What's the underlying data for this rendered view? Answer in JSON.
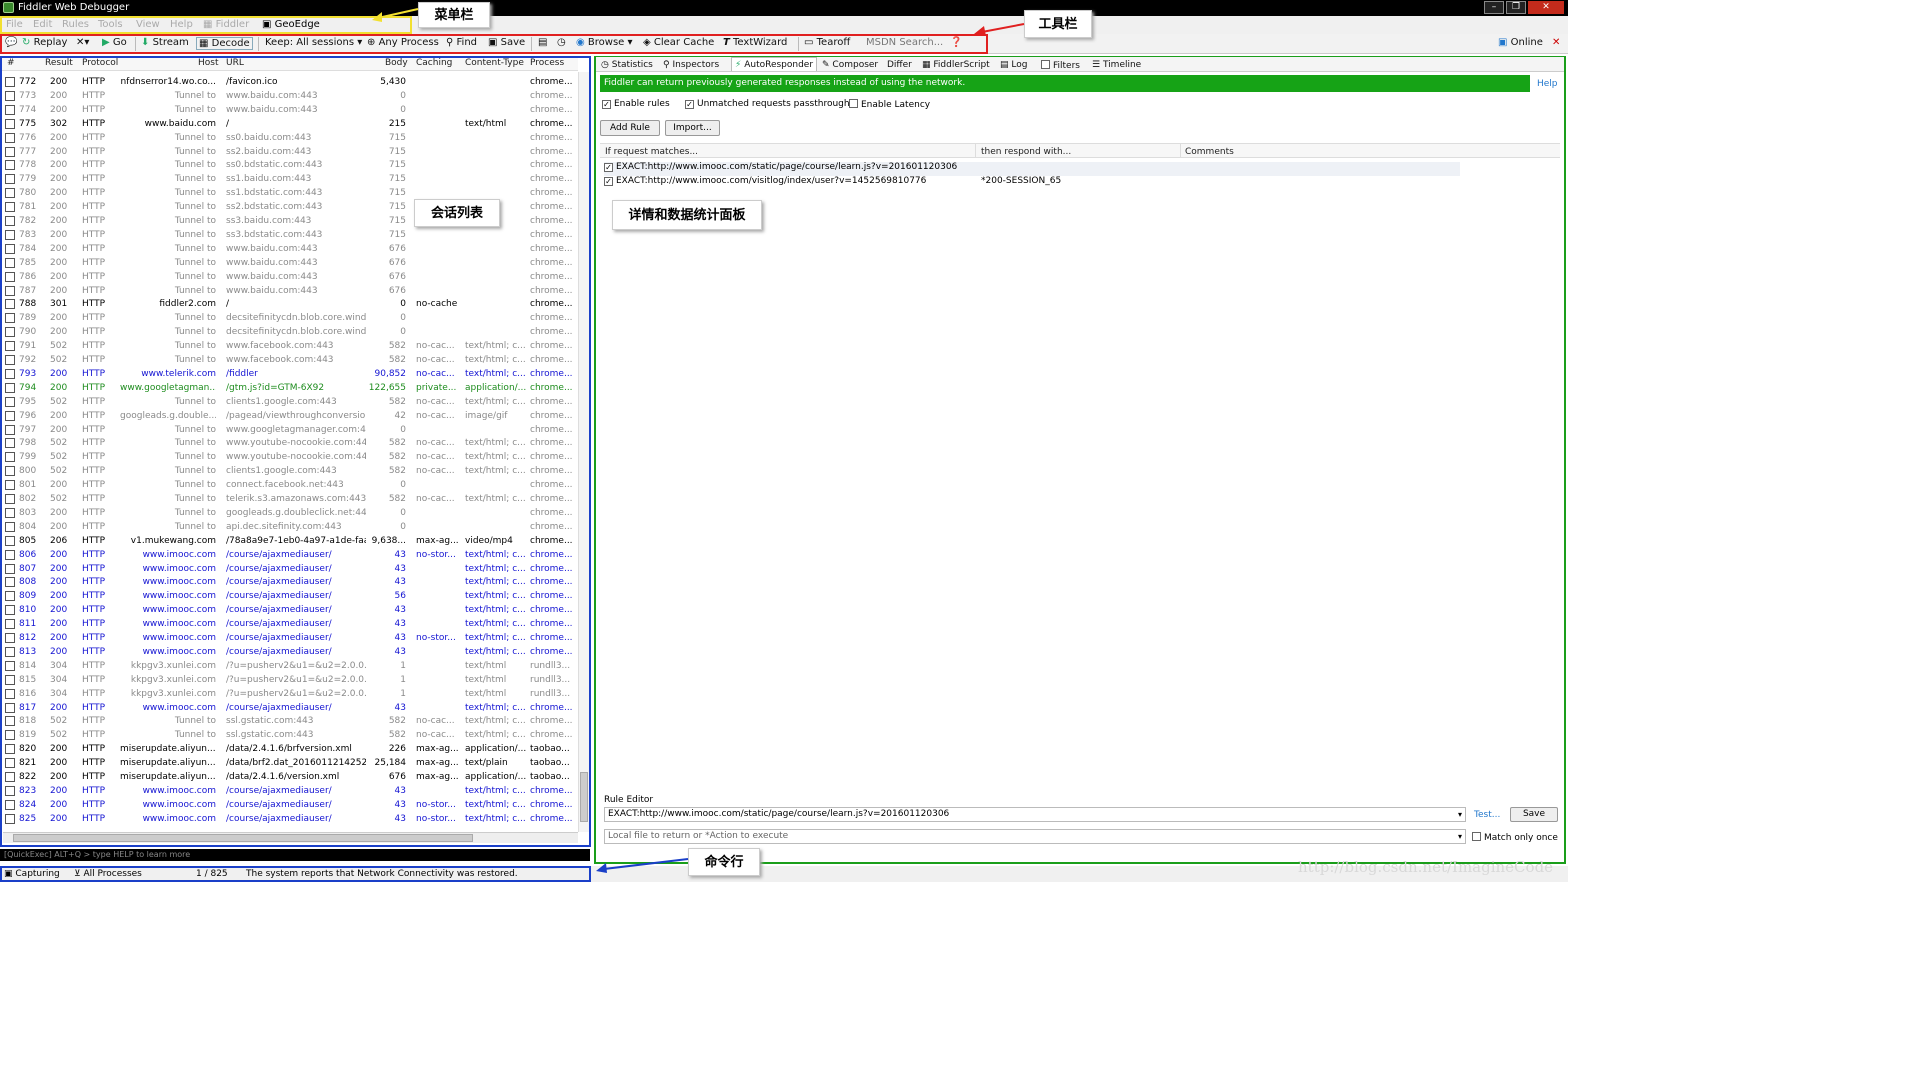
{
  "window": {
    "title": "Fiddler Web Debugger",
    "online": "Online"
  },
  "menu": [
    "File",
    "Edit",
    "Rules",
    "Tools",
    "View",
    "Help",
    "Fiddler",
    "GeoEdge"
  ],
  "toolbar": {
    "replay": "Replay",
    "go": "Go",
    "stream": "Stream",
    "decode": "Decode",
    "keep": "Keep: All sessions",
    "any_process": "Any Process",
    "find": "Find",
    "save": "Save",
    "browse": "Browse",
    "clear_cache": "Clear Cache",
    "textwizard": "TextWizard",
    "tearoff": "Tearoff",
    "msdn": "MSDN Search..."
  },
  "columns": [
    "#",
    "Result",
    "Protocol",
    "Host",
    "URL",
    "Body",
    "Caching",
    "Content-Type",
    "Process"
  ],
  "sessions": [
    [
      "772",
      "200",
      "HTTP",
      "nfdnserror14.wo.co...",
      "/favicon.ico",
      "5,430",
      "",
      "",
      "chrome...",
      "n"
    ],
    [
      "773",
      "200",
      "HTTP",
      "Tunnel to",
      "www.baidu.com:443",
      "0",
      "",
      "",
      "chrome...",
      "t"
    ],
    [
      "774",
      "200",
      "HTTP",
      "Tunnel to",
      "www.baidu.com:443",
      "0",
      "",
      "",
      "chrome...",
      "t"
    ],
    [
      "775",
      "302",
      "HTTP",
      "www.baidu.com",
      "/",
      "215",
      "",
      "text/html",
      "chrome...",
      "n"
    ],
    [
      "776",
      "200",
      "HTTP",
      "Tunnel to",
      "ss0.baidu.com:443",
      "715",
      "",
      "",
      "chrome...",
      "t"
    ],
    [
      "777",
      "200",
      "HTTP",
      "Tunnel to",
      "ss2.baidu.com:443",
      "715",
      "",
      "",
      "chrome...",
      "t"
    ],
    [
      "778",
      "200",
      "HTTP",
      "Tunnel to",
      "ss0.bdstatic.com:443",
      "715",
      "",
      "",
      "chrome...",
      "t"
    ],
    [
      "779",
      "200",
      "HTTP",
      "Tunnel to",
      "ss1.baidu.com:443",
      "715",
      "",
      "",
      "chrome...",
      "t"
    ],
    [
      "780",
      "200",
      "HTTP",
      "Tunnel to",
      "ss1.bdstatic.com:443",
      "715",
      "",
      "",
      "chrome...",
      "t"
    ],
    [
      "781",
      "200",
      "HTTP",
      "Tunnel to",
      "ss2.bdstatic.com:443",
      "715",
      "",
      "",
      "chrome...",
      "t"
    ],
    [
      "782",
      "200",
      "HTTP",
      "Tunnel to",
      "ss3.baidu.com:443",
      "715",
      "",
      "",
      "chrome...",
      "t"
    ],
    [
      "783",
      "200",
      "HTTP",
      "Tunnel to",
      "ss3.bdstatic.com:443",
      "715",
      "",
      "",
      "chrome...",
      "t"
    ],
    [
      "784",
      "200",
      "HTTP",
      "Tunnel to",
      "www.baidu.com:443",
      "676",
      "",
      "",
      "chrome...",
      "t"
    ],
    [
      "785",
      "200",
      "HTTP",
      "Tunnel to",
      "www.baidu.com:443",
      "676",
      "",
      "",
      "chrome...",
      "t"
    ],
    [
      "786",
      "200",
      "HTTP",
      "Tunnel to",
      "www.baidu.com:443",
      "676",
      "",
      "",
      "chrome...",
      "t"
    ],
    [
      "787",
      "200",
      "HTTP",
      "Tunnel to",
      "www.baidu.com:443",
      "676",
      "",
      "",
      "chrome...",
      "t"
    ],
    [
      "788",
      "301",
      "HTTP",
      "fiddler2.com",
      "/",
      "0",
      "no-cache",
      "",
      "chrome...",
      "n"
    ],
    [
      "789",
      "200",
      "HTTP",
      "Tunnel to",
      "decsitefinitycdn.blob.core.windo...",
      "0",
      "",
      "",
      "chrome...",
      "t"
    ],
    [
      "790",
      "200",
      "HTTP",
      "Tunnel to",
      "decsitefinitycdn.blob.core.windo...",
      "0",
      "",
      "",
      "chrome...",
      "t"
    ],
    [
      "791",
      "502",
      "HTTP",
      "Tunnel to",
      "www.facebook.com:443",
      "582",
      "no-cac...",
      "text/html; c...",
      "chrome...",
      "t"
    ],
    [
      "792",
      "502",
      "HTTP",
      "Tunnel to",
      "www.facebook.com:443",
      "582",
      "no-cac...",
      "text/html; c...",
      "chrome...",
      "t"
    ],
    [
      "793",
      "200",
      "HTTP",
      "www.telerik.com",
      "/fiddler",
      "90,852",
      "no-cac...",
      "text/html; c...",
      "chrome...",
      "b"
    ],
    [
      "794",
      "200",
      "HTTP",
      "www.googletagman...",
      "/gtm.js?id=GTM-6X92",
      "122,655",
      "private...",
      "application/...",
      "chrome...",
      "g"
    ],
    [
      "795",
      "502",
      "HTTP",
      "Tunnel to",
      "clients1.google.com:443",
      "582",
      "no-cac...",
      "text/html; c...",
      "chrome...",
      "t"
    ],
    [
      "796",
      "200",
      "HTTP",
      "googleads.g.double...",
      "/pagead/viewthroughconversion...",
      "42",
      "no-cac...",
      "image/gif",
      "chrome...",
      "t"
    ],
    [
      "797",
      "200",
      "HTTP",
      "Tunnel to",
      "www.googletagmanager.com:443",
      "0",
      "",
      "",
      "chrome...",
      "t"
    ],
    [
      "798",
      "502",
      "HTTP",
      "Tunnel to",
      "www.youtube-nocookie.com:443",
      "582",
      "no-cac...",
      "text/html; c...",
      "chrome...",
      "t"
    ],
    [
      "799",
      "502",
      "HTTP",
      "Tunnel to",
      "www.youtube-nocookie.com:443",
      "582",
      "no-cac...",
      "text/html; c...",
      "chrome...",
      "t"
    ],
    [
      "800",
      "502",
      "HTTP",
      "Tunnel to",
      "clients1.google.com:443",
      "582",
      "no-cac...",
      "text/html; c...",
      "chrome...",
      "t"
    ],
    [
      "801",
      "200",
      "HTTP",
      "Tunnel to",
      "connect.facebook.net:443",
      "0",
      "",
      "",
      "chrome...",
      "t"
    ],
    [
      "802",
      "502",
      "HTTP",
      "Tunnel to",
      "telerik.s3.amazonaws.com:443",
      "582",
      "no-cac...",
      "text/html; c...",
      "chrome...",
      "t"
    ],
    [
      "803",
      "200",
      "HTTP",
      "Tunnel to",
      "googleads.g.doubleclick.net:443",
      "0",
      "",
      "",
      "chrome...",
      "t"
    ],
    [
      "804",
      "200",
      "HTTP",
      "Tunnel to",
      "api.dec.sitefinity.com:443",
      "0",
      "",
      "",
      "chrome...",
      "t"
    ],
    [
      "805",
      "206",
      "HTTP",
      "v1.mukewang.com",
      "/78a8a9e7-1eb0-4a97-a1de-faa...",
      "9,638...",
      "max-ag...",
      "video/mp4",
      "chrome...",
      "n"
    ],
    [
      "806",
      "200",
      "HTTP",
      "www.imooc.com",
      "/course/ajaxmediauser/",
      "43",
      "no-stor...",
      "text/html; c...",
      "chrome...",
      "b"
    ],
    [
      "807",
      "200",
      "HTTP",
      "www.imooc.com",
      "/course/ajaxmediauser/",
      "43",
      "",
      "text/html; c...",
      "chrome...",
      "b"
    ],
    [
      "808",
      "200",
      "HTTP",
      "www.imooc.com",
      "/course/ajaxmediauser/",
      "43",
      "",
      "text/html; c...",
      "chrome...",
      "b"
    ],
    [
      "809",
      "200",
      "HTTP",
      "www.imooc.com",
      "/course/ajaxmediauser/",
      "56",
      "",
      "text/html; c...",
      "chrome...",
      "b"
    ],
    [
      "810",
      "200",
      "HTTP",
      "www.imooc.com",
      "/course/ajaxmediauser/",
      "43",
      "",
      "text/html; c...",
      "chrome...",
      "b"
    ],
    [
      "811",
      "200",
      "HTTP",
      "www.imooc.com",
      "/course/ajaxmediauser/",
      "43",
      "",
      "text/html; c...",
      "chrome...",
      "b"
    ],
    [
      "812",
      "200",
      "HTTP",
      "www.imooc.com",
      "/course/ajaxmediauser/",
      "43",
      "no-stor...",
      "text/html; c...",
      "chrome...",
      "b"
    ],
    [
      "813",
      "200",
      "HTTP",
      "www.imooc.com",
      "/course/ajaxmediauser/",
      "43",
      "",
      "text/html; c...",
      "chrome...",
      "b"
    ],
    [
      "814",
      "304",
      "HTTP",
      "kkpgv3.xunlei.com",
      "/?u=pusherv2&u1=&u2=2.0.0....",
      "1",
      "",
      "text/html",
      "rundll3...",
      "t"
    ],
    [
      "815",
      "304",
      "HTTP",
      "kkpgv3.xunlei.com",
      "/?u=pusherv2&u1=&u2=2.0.0....",
      "1",
      "",
      "text/html",
      "rundll3...",
      "t"
    ],
    [
      "816",
      "304",
      "HTTP",
      "kkpgv3.xunlei.com",
      "/?u=pusherv2&u1=&u2=2.0.0....",
      "1",
      "",
      "text/html",
      "rundll3...",
      "t"
    ],
    [
      "817",
      "200",
      "HTTP",
      "www.imooc.com",
      "/course/ajaxmediauser/",
      "43",
      "",
      "text/html; c...",
      "chrome...",
      "b"
    ],
    [
      "818",
      "502",
      "HTTP",
      "Tunnel to",
      "ssl.gstatic.com:443",
      "582",
      "no-cac...",
      "text/html; c...",
      "chrome...",
      "t"
    ],
    [
      "819",
      "502",
      "HTTP",
      "Tunnel to",
      "ssl.gstatic.com:443",
      "582",
      "no-cac...",
      "text/html; c...",
      "chrome...",
      "t"
    ],
    [
      "820",
      "200",
      "HTTP",
      "miserupdate.aliyun....",
      "/data/2.4.1.6/brfversion.xml",
      "226",
      "max-ag...",
      "application/...",
      "taobao...",
      "n"
    ],
    [
      "821",
      "200",
      "HTTP",
      "miserupdate.aliyun....",
      "/data/brf2.dat_20160112142520",
      "25,184",
      "max-ag...",
      "text/plain",
      "taobao...",
      "n"
    ],
    [
      "822",
      "200",
      "HTTP",
      "miserupdate.aliyun....",
      "/data/2.4.1.6/version.xml",
      "676",
      "max-ag...",
      "application/...",
      "taobao...",
      "n"
    ],
    [
      "823",
      "200",
      "HTTP",
      "www.imooc.com",
      "/course/ajaxmediauser/",
      "43",
      "",
      "text/html; c...",
      "chrome...",
      "b"
    ],
    [
      "824",
      "200",
      "HTTP",
      "www.imooc.com",
      "/course/ajaxmediauser/",
      "43",
      "no-stor...",
      "text/html; c...",
      "chrome...",
      "b"
    ],
    [
      "825",
      "200",
      "HTTP",
      "www.imooc.com",
      "/course/ajaxmediauser/",
      "43",
      "no-stor...",
      "text/html; c...",
      "chrome...",
      "b"
    ]
  ],
  "colors": {
    "t": "#8a8a8a",
    "n": "#000000",
    "b": "#1414d2",
    "g": "#1e8c1e",
    "frame_green": "#1a9e1a"
  },
  "tabs": [
    "Statistics",
    "Inspectors",
    "AutoResponder",
    "Composer",
    "Differ",
    "FiddlerScript",
    "Log",
    "Filters",
    "Timeline"
  ],
  "autoresponder": {
    "banner": "Fiddler can return previously generated responses instead of using the network.",
    "help": "Help",
    "enable_rules": "Enable rules",
    "unmatched": "Unmatched requests passthrough",
    "latency": "Enable Latency",
    "add_rule": "Add Rule",
    "import": "Import...",
    "col_match": "If request matches...",
    "col_respond": "then respond with...",
    "col_comments": "Comments",
    "rules": [
      {
        "match": "EXACT:http://www.imooc.com/static/page/course/learn.js?v=201601120306",
        "respond": ""
      },
      {
        "match": "EXACT:http://www.imooc.com/visitlog/index/user?v=1452569810776",
        "respond": "*200-SESSION_65"
      }
    ],
    "rule_editor": "Rule Editor",
    "editor_value": "EXACT:http://www.imooc.com/static/page/course/learn.js?v=201601120306",
    "test": "Test...",
    "save": "Save",
    "action_placeholder": "Local file to return or *Action to execute",
    "match_once": "Match only once"
  },
  "quickexec": "[QuickExec] ALT+Q > type HELP to learn more",
  "status": {
    "capturing": "Capturing",
    "processes": "All Processes",
    "count": "1 / 825",
    "message": "The system reports that Network Connectivity was restored."
  },
  "annotations": {
    "menubar": "菜单栏",
    "toolbar": "工具栏",
    "sessions": "会话列表",
    "details": "详情和数据统计面板",
    "cmdline": "命令行"
  },
  "watermark": "http://blog.csdn.net/ImagineCode"
}
